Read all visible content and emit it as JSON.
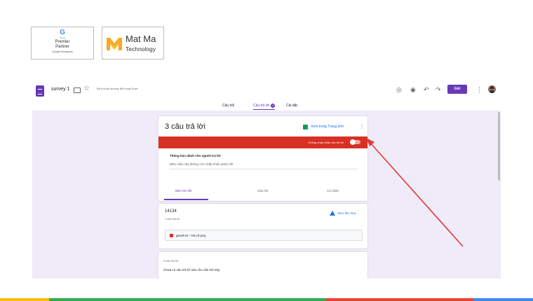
{
  "logos": {
    "google": {
      "g": "G",
      "small": "Cloud",
      "line1": "Premier",
      "line2": "Partner",
      "line3": "Google Workspace"
    },
    "matma": {
      "line1": "Mat Ma",
      "line2": "Technology"
    }
  },
  "header": {
    "title": "survey 1",
    "save_note": "Đã lưu tất cả thay đổi trong Drive",
    "send_label": "Gửi",
    "icons": [
      "palette-icon",
      "preview-icon",
      "undo-icon",
      "redo-icon",
      "more-icon"
    ]
  },
  "tabs": {
    "questions": "Câu hỏi",
    "responses": "Câu trả lời",
    "responses_count": "3",
    "settings": "Cài đặt"
  },
  "summary_card": {
    "title": "3 câu trả lời",
    "sheets_link": "Xem trong Trang tính",
    "banner_text": "Không chấp nhận câu trả lời",
    "accepting_responses": false,
    "notice_label": "Thông báo dành cho người trả lời",
    "notice_value": "Biểu mẫu này không còn chấp nhận phản hồi",
    "sub_tabs": [
      "Bản tóm tắt",
      "Câu hỏi",
      "Cá nhân"
    ],
    "active_sub_tab": 0
  },
  "question_card": {
    "id": "14134",
    "responses": "1 câu trả lời",
    "drive_link": "Xem thư mục",
    "file_name": "gmail-44 - Hà Lê.png"
  },
  "empty_card": {
    "count": "0 câu trả lời",
    "message": "Chưa có câu trả lời nào cho câu hỏi này."
  },
  "colors": {
    "accent": "#673ab7",
    "banner": "#d93025",
    "background": "#f0ebf8",
    "arrow": "#e53935"
  }
}
